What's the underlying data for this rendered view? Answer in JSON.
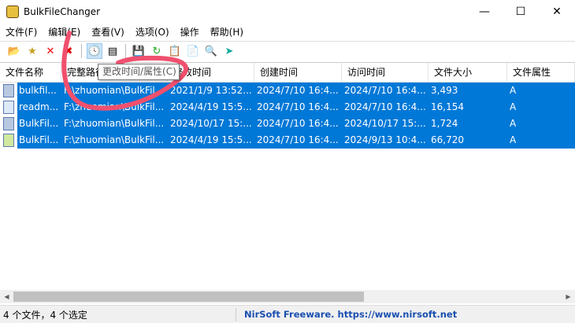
{
  "window": {
    "title": "BulkFileChanger"
  },
  "menu": [
    "文件(F)",
    "编辑(E)",
    "查看(V)",
    "选项(O)",
    "操作",
    "帮助(H)"
  ],
  "toolbar_tooltip": "更改时间/属性(C)",
  "columns": [
    "文件名称",
    "完整路径",
    "修改时间",
    "创建时间",
    "访问时间",
    "文件大小",
    "文件属性"
  ],
  "rows": [
    [
      "bulkfil...",
      "F:\\zhuomian\\BulkFil...",
      "2021/1/9 13:52...",
      "2024/7/10 16:4...",
      "2024/7/10 16:4...",
      "3,493",
      "A"
    ],
    [
      "readm...",
      "F:\\zhuomian\\BulkFil...",
      "2024/4/19 15:5...",
      "2024/7/10 16:4...",
      "2024/7/10 16:4...",
      "16,154",
      "A"
    ],
    [
      "BulkFil...",
      "F:\\zhuomian\\BulkFil...",
      "2024/10/17 15:...",
      "2024/7/10 16:4...",
      "2024/10/17 15:...",
      "1,724",
      "A"
    ],
    [
      "BulkFil...",
      "F:\\zhuomian\\BulkFil...",
      "2024/4/19 15:5...",
      "2024/7/10 16:4...",
      "2024/9/13 10:4...",
      "66,720",
      "A"
    ]
  ],
  "status": {
    "count": "4 个文件，4 个选定",
    "brand": "NirSoft Freeware. https://www.nirsoft.net"
  },
  "colors": {
    "selection": "#0078d7",
    "annotation": "#f0506e"
  }
}
